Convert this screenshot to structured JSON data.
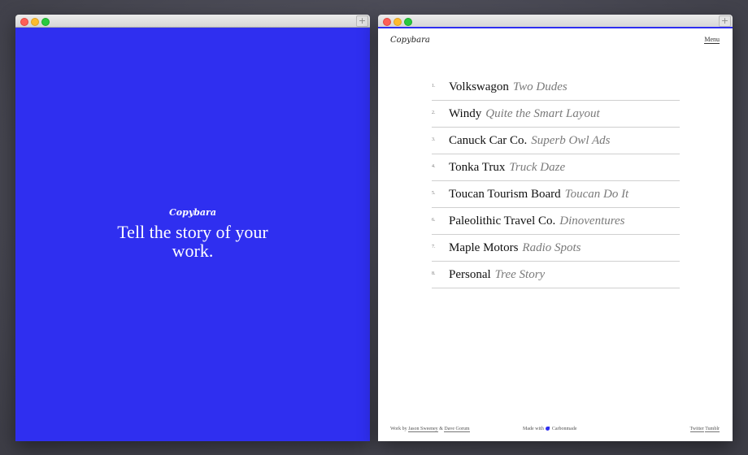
{
  "left_window": {
    "logo": "Copybara",
    "tagline": "Tell the story of your work.",
    "plus_label": "+"
  },
  "right_window": {
    "logo": "Copybara",
    "menu_label": "Menu",
    "plus_label": "+",
    "projects": [
      {
        "num": "1.",
        "client": "Volkswagon",
        "project": "Two Dudes"
      },
      {
        "num": "2.",
        "client": "Windy",
        "project": "Quite the Smart Layout"
      },
      {
        "num": "3.",
        "client": "Canuck Car Co.",
        "project": "Superb Owl Ads"
      },
      {
        "num": "4.",
        "client": "Tonka Trux",
        "project": "Truck Daze"
      },
      {
        "num": "5.",
        "client": "Toucan Tourism Board",
        "project": "Toucan Do It"
      },
      {
        "num": "6.",
        "client": "Paleolithic Travel Co.",
        "project": "Dinoventures"
      },
      {
        "num": "7.",
        "client": "Maple Motors",
        "project": "Radio Spots"
      },
      {
        "num": "8.",
        "client": "Personal",
        "project": "Tree Story"
      }
    ],
    "footer": {
      "work_by": "Work by",
      "author1": "Jason Sweeney",
      "amp": "&",
      "author2": "Dave Gorum",
      "made_with": "Made with",
      "carbonmade": "Carbonmade",
      "twitter": "Twitter",
      "tumblr": "Tumblr"
    }
  },
  "colors": {
    "accent_blue": "#2f2ff0"
  }
}
